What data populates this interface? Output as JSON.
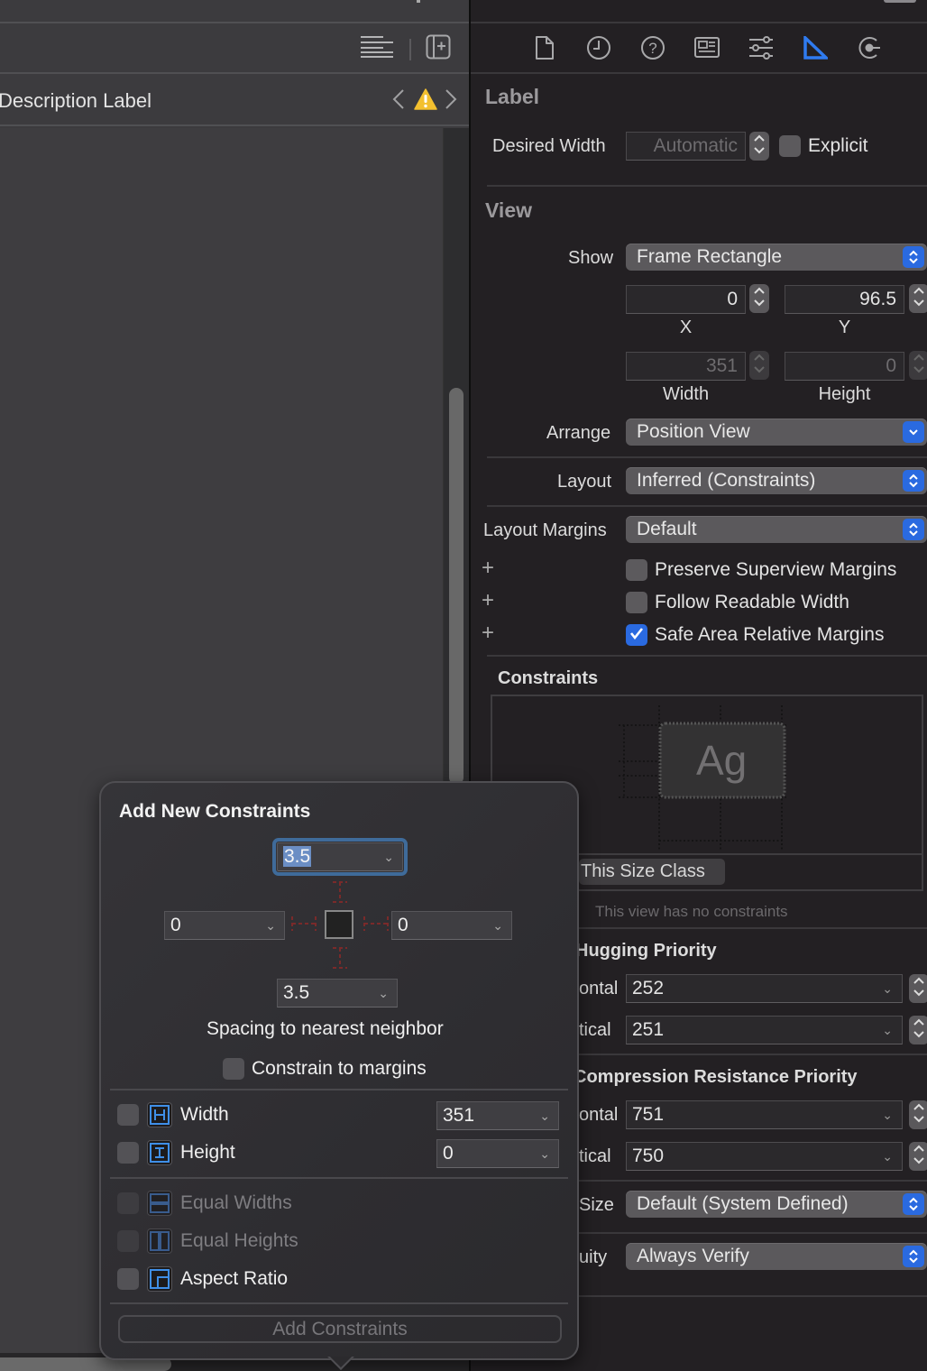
{
  "editor": {
    "jump_bar_title": "Description Label",
    "icons": {
      "editor_options": "lines-icon",
      "add_editor": "add-editor-icon",
      "prev_issue": "chevron-left-icon",
      "warning": "warning-icon",
      "next_issue": "chevron-right-icon"
    }
  },
  "inspector": {
    "tabs": [
      {
        "name": "file-inspector",
        "icon": "document-icon",
        "active": false
      },
      {
        "name": "history-inspector",
        "icon": "clock-icon",
        "active": false
      },
      {
        "name": "quick-help-inspector",
        "icon": "question-icon",
        "active": false
      },
      {
        "name": "identity-inspector",
        "icon": "identity-card-icon",
        "active": false
      },
      {
        "name": "attributes-inspector",
        "icon": "sliders-icon",
        "active": false
      },
      {
        "name": "size-inspector",
        "icon": "ruler-triangle-icon",
        "active": true
      },
      {
        "name": "connections-inspector",
        "icon": "connection-icon",
        "active": false
      }
    ],
    "accent_color": "#2a6ae0",
    "label_section": {
      "title": "Label",
      "desired_width_label": "Desired Width",
      "desired_width_value": "Automatic",
      "explicit_label": "Explicit",
      "explicit_checked": false
    },
    "view_section": {
      "title": "View",
      "show_label": "Show",
      "show_value": "Frame Rectangle",
      "x_value": "0",
      "x_label": "X",
      "y_value": "96.5",
      "y_label": "Y",
      "width_value": "351",
      "width_label": "Width",
      "height_value": "0",
      "height_label": "Height",
      "arrange_label": "Arrange",
      "arrange_value": "Position View",
      "layout_label": "Layout",
      "layout_value": "Inferred (Constraints)",
      "layout_margins_label": "Layout Margins",
      "layout_margins_value": "Default",
      "checkboxes": [
        {
          "label": "Preserve Superview Margins",
          "checked": false
        },
        {
          "label": "Follow Readable Width",
          "checked": false
        },
        {
          "label": "Safe Area Relative Margins",
          "checked": true
        }
      ]
    },
    "constraints_section": {
      "title": "Constraints",
      "preview_text": "Ag",
      "size_class_button": "This Size Class",
      "empty_message": "This view has no constraints"
    },
    "hugging": {
      "title": "Hugging Priority",
      "horizontal_label": "ontal",
      "horizontal_value": "252",
      "vertical_label": "tical",
      "vertical_value": "251"
    },
    "compression": {
      "title": "Compression Resistance Priority",
      "horizontal_label": "ontal",
      "horizontal_value": "751",
      "vertical_label": "tical",
      "vertical_value": "750"
    },
    "intrinsic_size": {
      "label": "Size",
      "value": "Default (System Defined)"
    },
    "ambiguity": {
      "label": "uity",
      "value": "Always Verify"
    }
  },
  "popover": {
    "title": "Add New Constraints",
    "top_value": "3.5",
    "left_value": "0",
    "right_value": "0",
    "bottom_value": "3.5",
    "spacing_label": "Spacing to nearest neighbor",
    "constrain_margins_label": "Constrain to margins",
    "constrain_margins_checked": false,
    "width_label": "Width",
    "width_value": "351",
    "width_checked": false,
    "height_label": "Height",
    "height_value": "0",
    "height_checked": false,
    "equal_widths_label": "Equal Widths",
    "equal_heights_label": "Equal Heights",
    "aspect_ratio_label": "Aspect Ratio",
    "add_button": "Add Constraints",
    "guide_color": "#7a2a2a"
  }
}
